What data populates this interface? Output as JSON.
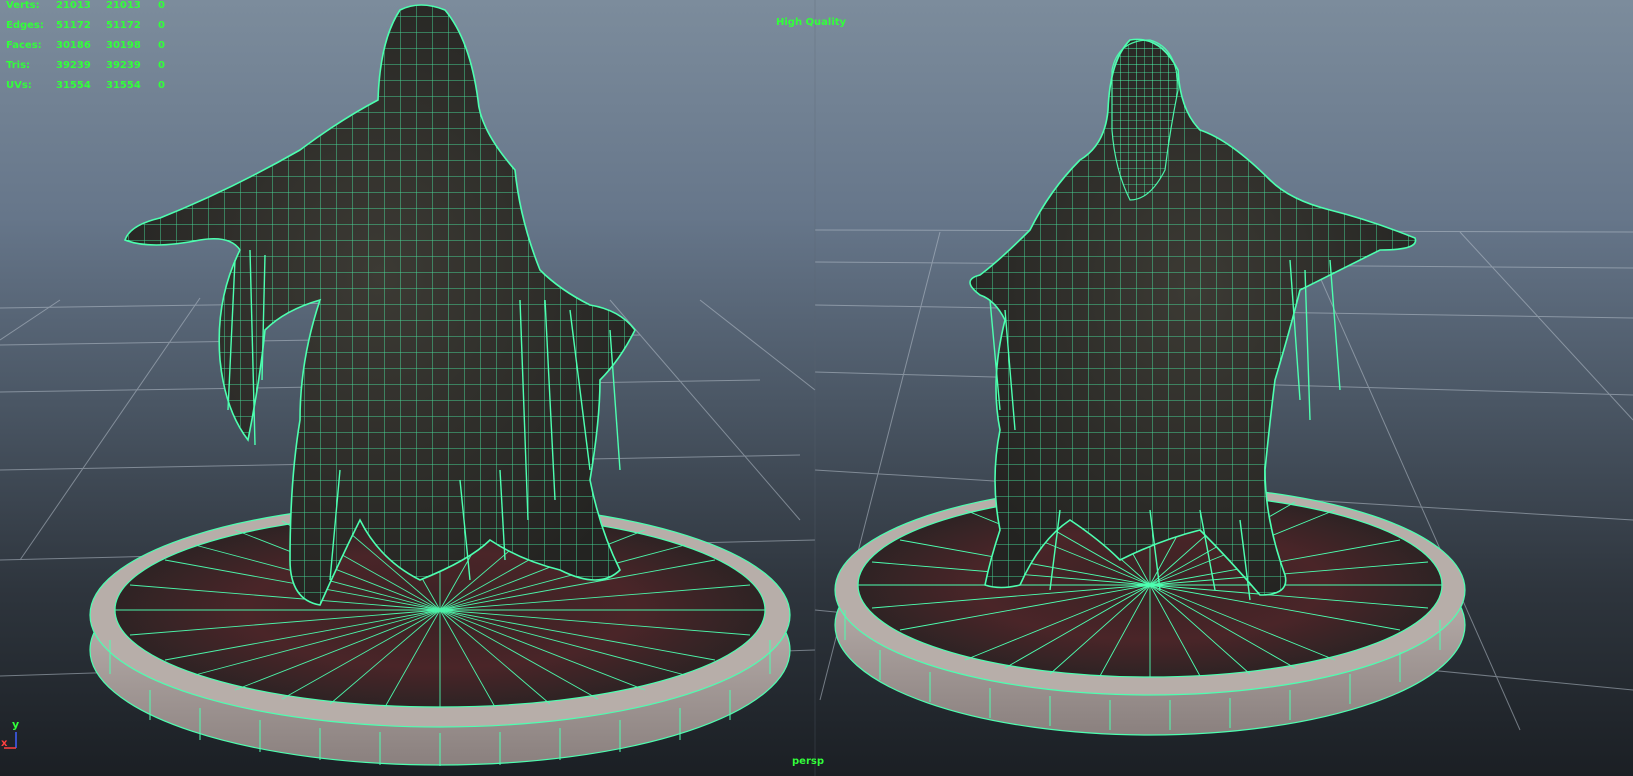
{
  "hud": {
    "rows": [
      {
        "label": "Verts:",
        "v1": "21013",
        "v2": "21013",
        "v3": "0"
      },
      {
        "label": "Edges:",
        "v1": "51172",
        "v2": "51172",
        "v3": "0"
      },
      {
        "label": "Faces:",
        "v1": "30186",
        "v2": "30198",
        "v3": "0"
      },
      {
        "label": "Tris:",
        "v1": "39239",
        "v2": "39239",
        "v3": "0"
      },
      {
        "label": "UVs:",
        "v1": "31554",
        "v2": "31554",
        "v3": "0"
      }
    ]
  },
  "viewport": {
    "quality_label": "High Quality",
    "camera_label": "persp",
    "axis_y_label": "y",
    "axis_x_label": "x"
  },
  "colors": {
    "hud_text": "#32ff3a",
    "wireframe": "#4dffb0",
    "axis_x": "#ff4040"
  }
}
